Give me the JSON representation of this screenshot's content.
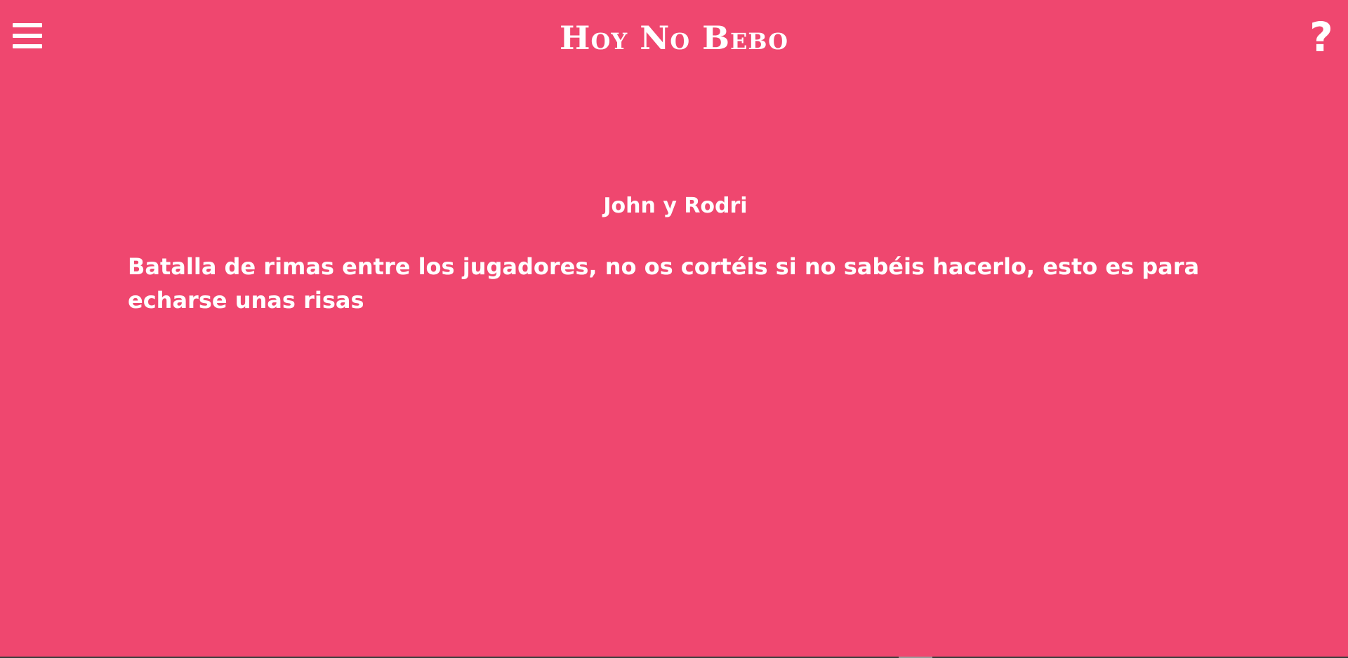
{
  "header": {
    "title": "Hoy No Bebo",
    "menu_icon": "hamburger-menu-icon",
    "help_label": "?",
    "help_icon": "question-mark-icon"
  },
  "card": {
    "players": "John y Rodri",
    "challenge": "Batalla de rimas entre los jugadores, no os cortéis si no sabéis hacerlo, esto es para echarse unas risas"
  },
  "colors": {
    "background": "#ef476f",
    "text": "#ffffff"
  }
}
